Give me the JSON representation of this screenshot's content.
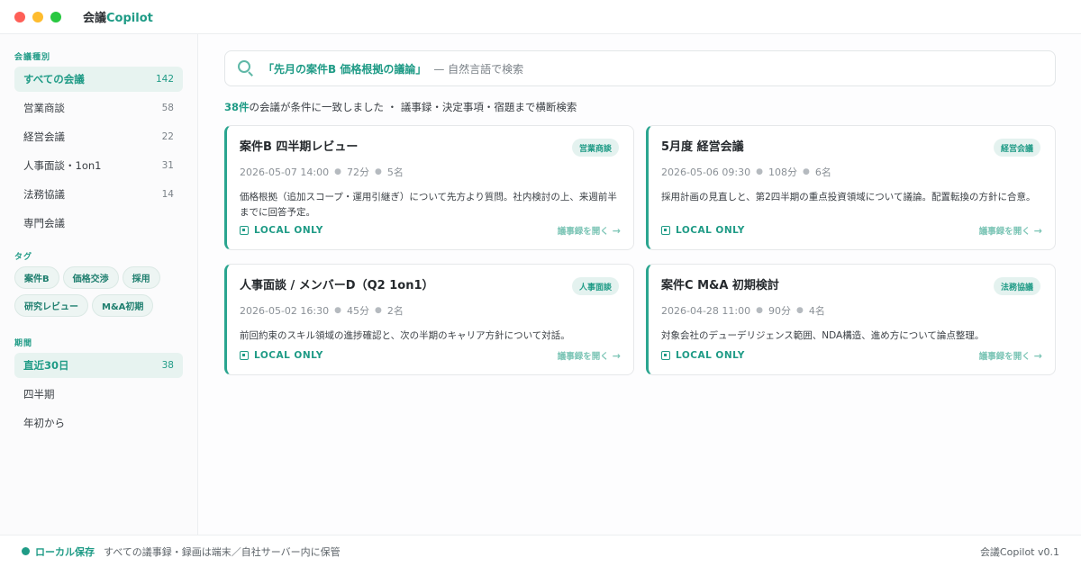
{
  "app": {
    "title_prefix": "会議",
    "title_accent": "Copilot"
  },
  "sidebar": {
    "sections": {
      "types": "会議種別",
      "tags": "タグ",
      "period": "期間"
    },
    "types": [
      {
        "label": "すべての会議",
        "count": "142"
      },
      {
        "label": "営業商談",
        "count": "58"
      },
      {
        "label": "経営会議",
        "count": "22"
      },
      {
        "label": "人事面談・1on1",
        "count": "31"
      },
      {
        "label": "法務協議",
        "count": "14"
      },
      {
        "label": "専門会議",
        "count": ""
      }
    ],
    "tags": [
      "案件B",
      "価格交渉",
      "採用",
      "研究レビュー",
      "M&A初期"
    ],
    "periods": [
      {
        "label": "直近30日",
        "count": "38"
      },
      {
        "label": "四半期",
        "count": ""
      },
      {
        "label": "年初から",
        "count": ""
      }
    ]
  },
  "search": {
    "query": "「先月の案件B 価格根拠の議論」",
    "hint": "— 自然言語で検索"
  },
  "results": {
    "count": "38件",
    "text": "の会議が条件に一致しました ・ 議事録・決定事項・宿題まで横断検索"
  },
  "cards": [
    {
      "title": "案件B 四半期レビュー",
      "badge": "営業商談",
      "datetime": "2026-05-07 14:00",
      "duration": "72分",
      "attendees": "5名",
      "summary": "価格根拠（追加スコープ・運用引継ぎ）について先方より質問。社内検討の上、来週前半までに回答予定。",
      "local": "LOCAL ONLY",
      "open": "議事録を開く"
    },
    {
      "title": "5月度 経営会議",
      "badge": "経営会議",
      "datetime": "2026-05-06 09:30",
      "duration": "108分",
      "attendees": "6名",
      "summary": "採用計画の見直しと、第2四半期の重点投資領域について議論。配置転換の方針に合意。",
      "local": "LOCAL ONLY",
      "open": "議事録を開く"
    },
    {
      "title": "人事面談 / メンバーD（Q2 1on1）",
      "badge": "人事面談",
      "datetime": "2026-05-02 16:30",
      "duration": "45分",
      "attendees": "2名",
      "summary": "前回約束のスキル領域の進捗確認と、次の半期のキャリア方針について対話。",
      "local": "LOCAL ONLY",
      "open": "議事録を開く"
    },
    {
      "title": "案件C M&A 初期検討",
      "badge": "法務協議",
      "datetime": "2026-04-28 11:00",
      "duration": "90分",
      "attendees": "4名",
      "summary": "対象会社のデューデリジェンス範囲、NDA構造、進め方について論点整理。",
      "local": "LOCAL ONLY",
      "open": "議事録を開く"
    }
  ],
  "footer": {
    "status": "ローカル保存",
    "note": "すべての議事録・録画は端末／自社サーバー内に保管",
    "version": "会議Copilot v0.1"
  },
  "colors": {
    "accent": "#1f9b86",
    "accent_light": "#e7f3f0"
  },
  "icons": [
    "search-icon",
    "local-only-icon",
    "arrow-right-icon",
    "status-dot-icon"
  ]
}
